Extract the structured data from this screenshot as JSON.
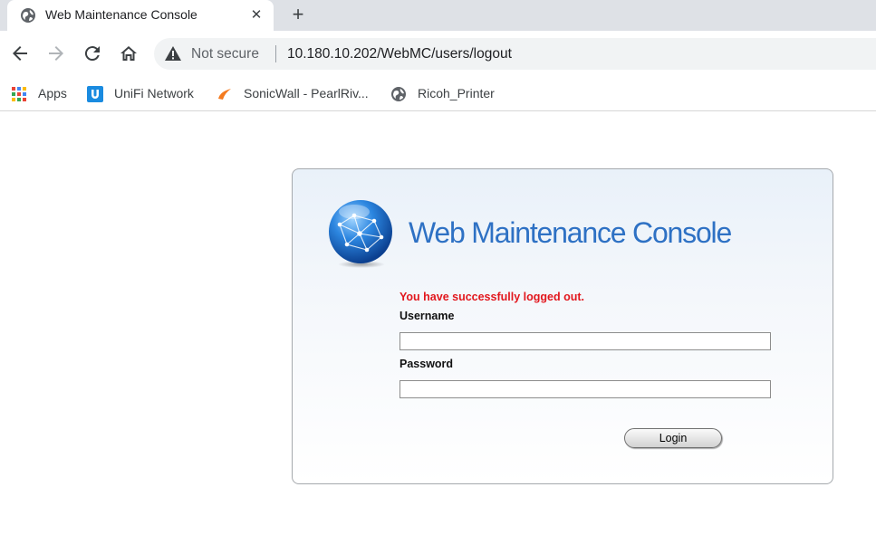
{
  "browser": {
    "tab": {
      "title": "Web Maintenance Console",
      "close_glyph": "✕"
    },
    "new_tab_glyph": "+",
    "omnibox": {
      "security_label": "Not secure",
      "url": "10.180.10.202/WebMC/users/logout"
    },
    "bookmarks": [
      {
        "label": "Apps",
        "icon": "apps-grid-icon"
      },
      {
        "label": "UniFi Network",
        "icon": "unifi-icon"
      },
      {
        "label": "SonicWall - PearlRiv...",
        "icon": "sonicwall-icon"
      },
      {
        "label": "Ricoh_Printer",
        "icon": "globe-icon"
      }
    ]
  },
  "page": {
    "brand_title": "Web Maintenance Console",
    "status_message": "You have successfully logged out.",
    "username_label": "Username",
    "username_value": "",
    "password_label": "Password",
    "password_value": "",
    "login_button": "Login"
  },
  "colors": {
    "brand_blue": "#2e71c4",
    "error_red": "#e2171d",
    "panel_border": "#a5a9ad",
    "tabstrip": "#dee1e6"
  }
}
